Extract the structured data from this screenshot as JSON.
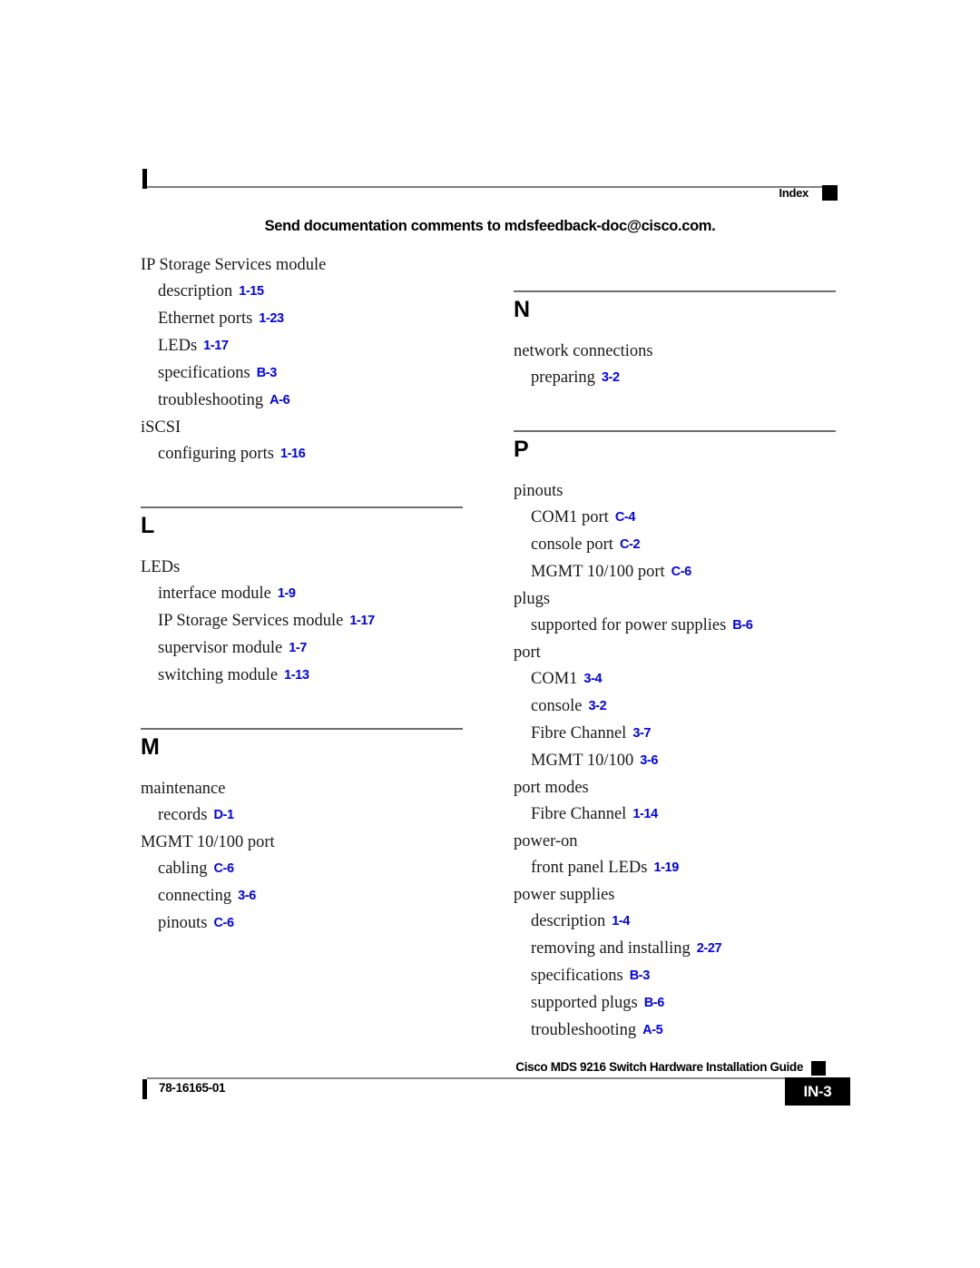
{
  "header": {
    "section_label": "Index"
  },
  "feedback_banner": {
    "text": "Send documentation comments to mdsfeedback-doc@cisco.com."
  },
  "columns": {
    "left": [
      {
        "letter": null,
        "entries": [
          {
            "level": 0,
            "term": "IP Storage Services module",
            "page": null
          },
          {
            "level": 1,
            "term": "description",
            "page": "1-15"
          },
          {
            "level": 1,
            "term": "Ethernet ports",
            "page": "1-23"
          },
          {
            "level": 1,
            "term": "LEDs",
            "page": "1-17"
          },
          {
            "level": 1,
            "term": "specifications",
            "page": "B-3"
          },
          {
            "level": 1,
            "term": "troubleshooting",
            "page": "A-6"
          },
          {
            "level": 0,
            "term": "iSCSI",
            "page": null
          },
          {
            "level": 1,
            "term": "configuring ports",
            "page": "1-16"
          }
        ]
      },
      {
        "letter": "L",
        "entries": [
          {
            "level": 0,
            "term": "LEDs",
            "page": null
          },
          {
            "level": 1,
            "term": "interface module",
            "page": "1-9"
          },
          {
            "level": 1,
            "term": "IP Storage Services module",
            "page": "1-17"
          },
          {
            "level": 1,
            "term": "supervisor module",
            "page": "1-7"
          },
          {
            "level": 1,
            "term": "switching module",
            "page": "1-13"
          }
        ]
      },
      {
        "letter": "M",
        "entries": [
          {
            "level": 0,
            "term": "maintenance",
            "page": null
          },
          {
            "level": 1,
            "term": "records",
            "page": "D-1"
          },
          {
            "level": 0,
            "term": "MGMT 10/100 port",
            "page": null
          },
          {
            "level": 1,
            "term": "cabling",
            "page": "C-6"
          },
          {
            "level": 1,
            "term": "connecting",
            "page": "3-6"
          },
          {
            "level": 1,
            "term": "pinouts",
            "page": "C-6"
          }
        ]
      }
    ],
    "right": [
      {
        "letter": "N",
        "entries": [
          {
            "level": 0,
            "term": "network connections",
            "page": null
          },
          {
            "level": 1,
            "term": "preparing",
            "page": "3-2"
          }
        ]
      },
      {
        "letter": "P",
        "entries": [
          {
            "level": 0,
            "term": "pinouts",
            "page": null
          },
          {
            "level": 1,
            "term": "COM1 port",
            "page": "C-4"
          },
          {
            "level": 1,
            "term": "console port",
            "page": "C-2"
          },
          {
            "level": 1,
            "term": "MGMT 10/100 port",
            "page": "C-6"
          },
          {
            "level": 0,
            "term": "plugs",
            "page": null
          },
          {
            "level": 1,
            "term": "supported for power supplies",
            "page": "B-6"
          },
          {
            "level": 0,
            "term": "port",
            "page": null
          },
          {
            "level": 1,
            "term": "COM1",
            "page": "3-4"
          },
          {
            "level": 1,
            "term": "console",
            "page": "3-2"
          },
          {
            "level": 1,
            "term": "Fibre Channel",
            "page": "3-7"
          },
          {
            "level": 1,
            "term": "MGMT 10/100",
            "page": "3-6"
          },
          {
            "level": 0,
            "term": "port modes",
            "page": null
          },
          {
            "level": 1,
            "term": "Fibre Channel",
            "page": "1-14"
          },
          {
            "level": 0,
            "term": "power-on",
            "page": null
          },
          {
            "level": 1,
            "term": "front panel LEDs",
            "page": "1-19"
          },
          {
            "level": 0,
            "term": "power supplies",
            "page": null
          },
          {
            "level": 1,
            "term": "description",
            "page": "1-4"
          },
          {
            "level": 1,
            "term": "removing and installing",
            "page": "2-27"
          },
          {
            "level": 1,
            "term": "specifications",
            "page": "B-3"
          },
          {
            "level": 1,
            "term": "supported plugs",
            "page": "B-6"
          },
          {
            "level": 1,
            "term": "troubleshooting",
            "page": "A-5"
          }
        ]
      }
    ]
  },
  "footer": {
    "guide_title": "Cisco MDS 9216 Switch Hardware Installation Guide",
    "doc_number": "78-16165-01",
    "page_badge": "IN-3"
  },
  "colors": {
    "page_number_blue": "#0000FF",
    "rule_gray": "#6E6E6E",
    "text_black": "#000000"
  }
}
